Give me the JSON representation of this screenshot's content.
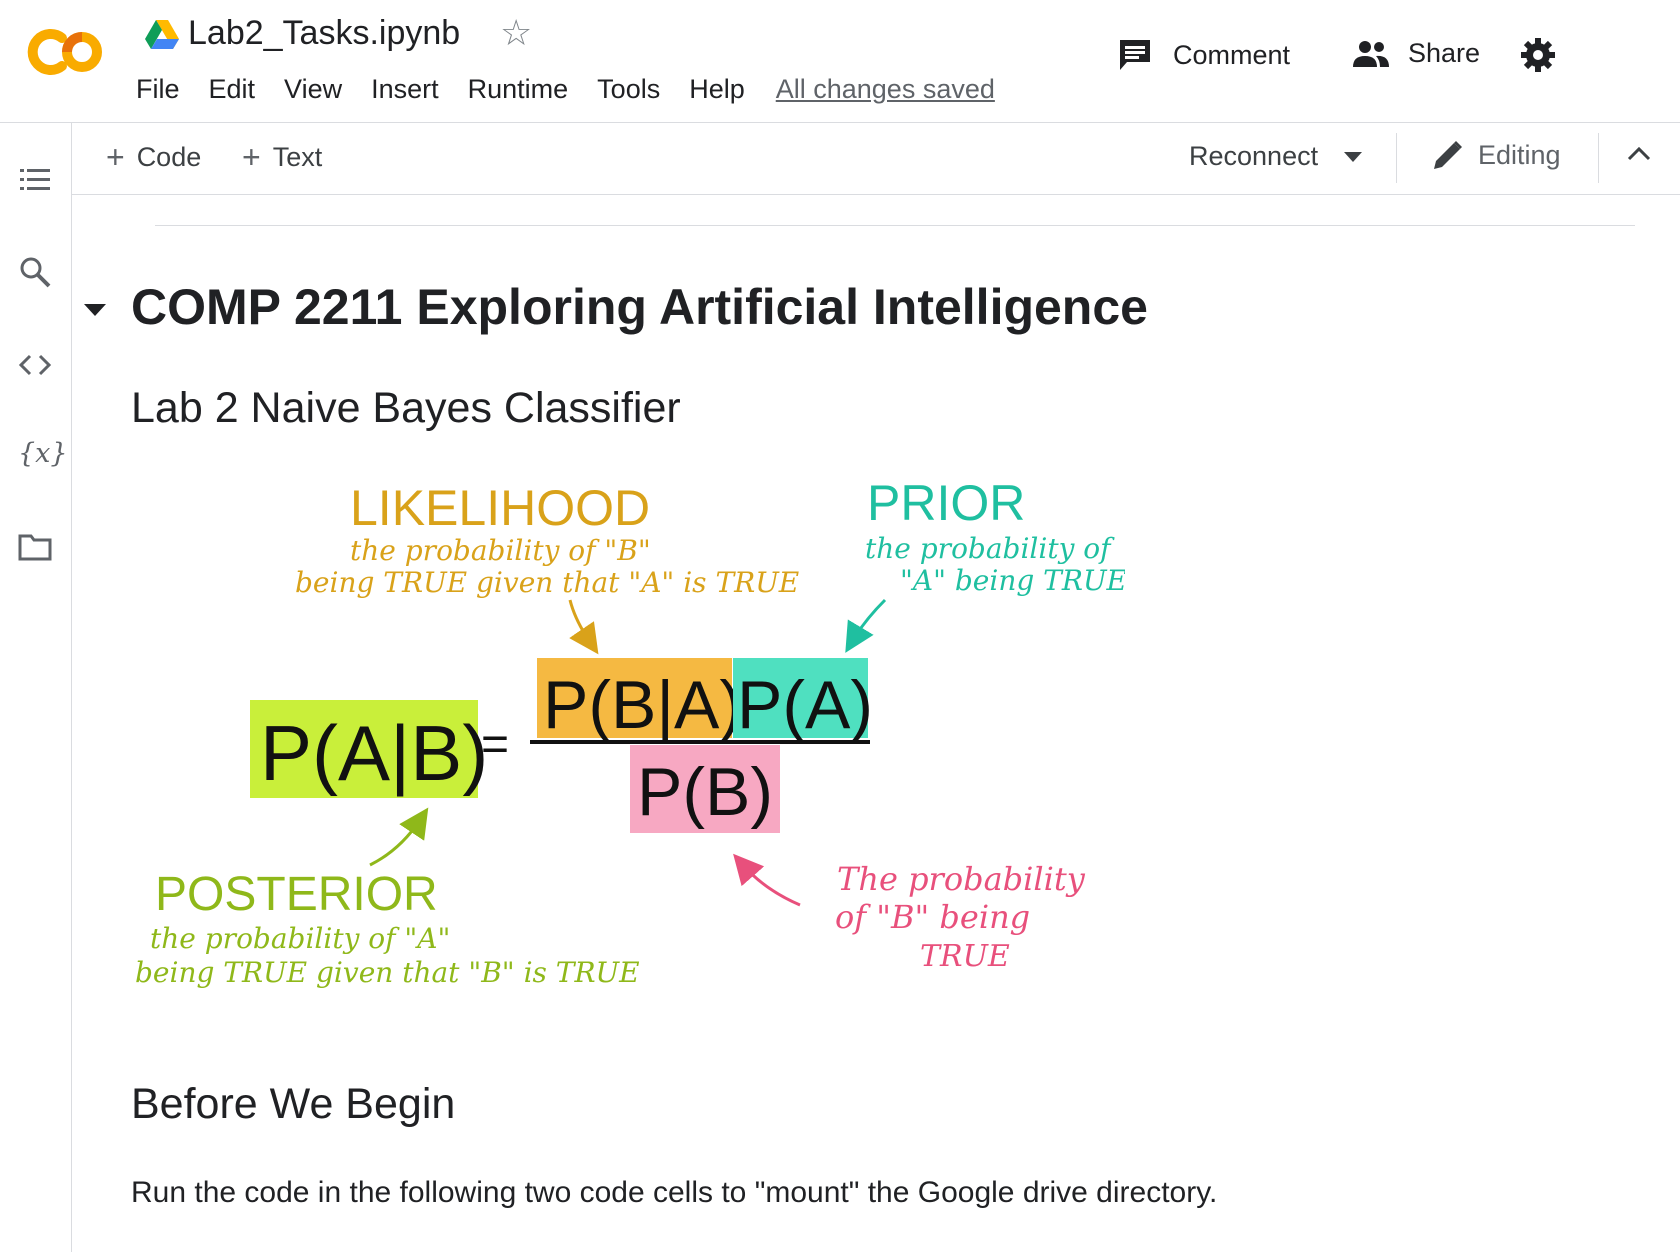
{
  "header": {
    "title": "Lab2_Tasks.ipynb",
    "menu": [
      "File",
      "Edit",
      "View",
      "Insert",
      "Runtime",
      "Tools",
      "Help"
    ],
    "save_status": "All changes saved",
    "comment_label": "Comment",
    "share_label": "Share",
    "logo_text": "CO"
  },
  "toolbar": {
    "add_code_label": "Code",
    "add_text_label": "Text",
    "reconnect_label": "Reconnect",
    "mode_label": "Editing"
  },
  "sidebar": {
    "icons": [
      "table-of-contents-icon",
      "search-icon",
      "code-snippets-icon",
      "variables-icon",
      "files-icon"
    ],
    "variables_glyph": "{x}"
  },
  "content": {
    "h1": "COMP 2211 Exploring Artificial Intelligence",
    "h2": "Lab 2 Naive Bayes Classifier",
    "h3": "Before We Begin",
    "paragraph": "Run the code in the following two code cells to \"mount\" the Google drive directory."
  },
  "diagram": {
    "lhs": "P(A|B)",
    "equals": "=",
    "numerator_likelihood": "P(B|A)",
    "numerator_prior": "P(A)",
    "denominator": "P(B)",
    "likelihood_title": "LIKELIHOOD",
    "likelihood_line1": "the probability of \"B\"",
    "likelihood_line2": "being TRUE given that \"A\" is TRUE",
    "prior_title": "PRIOR",
    "prior_line1": "the probability of",
    "prior_line2": "\"A\" being TRUE",
    "posterior_title": "POSTERIOR",
    "posterior_line1": "the probability of \"A\"",
    "posterior_line2": "being TRUE given that \"B\" is TRUE",
    "evidence_line1": "The probability",
    "evidence_line2": "of \"B\" being",
    "evidence_line3": "TRUE",
    "colors": {
      "likelihood": "#f5b942",
      "prior": "#4fe0c0",
      "posterior": "#c9ef3a",
      "evidence": "#f7a8c2",
      "likelihood_ink": "#d9a21a",
      "prior_ink": "#1fbfa0",
      "posterior_ink": "#8fb81a",
      "evidence_ink": "#e8507c"
    }
  }
}
